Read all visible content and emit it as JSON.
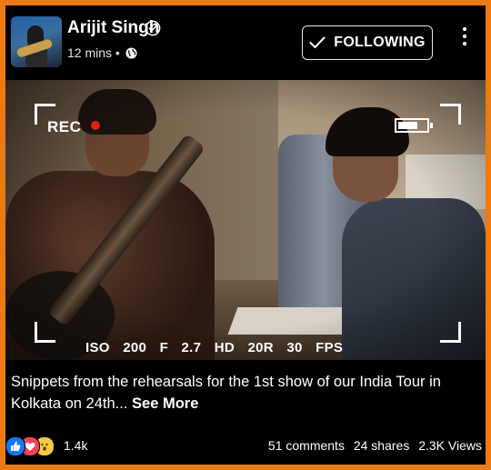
{
  "post": {
    "author": "Arijit Singh",
    "time": "12 mins",
    "separator": "•",
    "follow_label": "FOLLOWING",
    "caption": "Snippets from the rehearsals for the 1st show of our India Tour in Kolkata on 24th...",
    "see_more": "See More"
  },
  "video_overlay": {
    "rec_label": "REC",
    "readout": "ISO 200  F 2.7  HD 20R  30 FPS",
    "battery_level": 0.7,
    "rec_color": "#e0201c"
  },
  "footer": {
    "reaction_count": "1.4k",
    "comments": "51 comments",
    "shares": "24 shares",
    "views": "2.3K Views"
  },
  "icons": {
    "verified": "verified-badge-icon",
    "privacy": "globe-icon",
    "more": "more-vertical-icon",
    "follow_check": "check-icon",
    "reactions": [
      "like-icon",
      "love-icon",
      "wow-icon"
    ]
  },
  "colors": {
    "border": "#ec7a12",
    "background": "#000000",
    "like": "#1877f2",
    "love": "#f0445b",
    "wow": "#f7c948"
  }
}
